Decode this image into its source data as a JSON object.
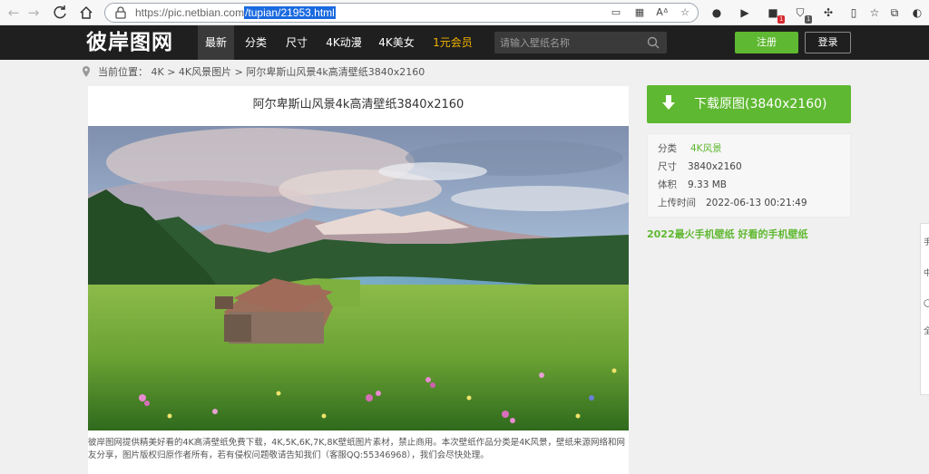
{
  "browser": {
    "url_host": "https://pic.netbian.com",
    "url_path": "/tupian/21953.html",
    "extension_badges": [
      "1",
      "1"
    ]
  },
  "site": {
    "logo": "彼岸图网",
    "nav": [
      "最新",
      "分类",
      "尺寸",
      "4K动漫",
      "4K美女",
      "1元会员"
    ],
    "search_placeholder": "请输入壁纸名称",
    "register": "注册",
    "login": "登录"
  },
  "breadcrumb": "当前位置： 4K > 4K风景图片 > 阿尔卑斯山风景4k高清壁纸3840x2160",
  "main": {
    "title": "阿尔卑斯山风景4k高清壁纸3840x2160",
    "description": "彼岸图网提供精美好看的4K高清壁纸免费下载，4K,5K,6K,7K,8K壁纸图片素材，禁止商用。本次壁纸作品分类是4K风景，壁纸来源网络和网友分享，图片版权归原作者所有，若有侵权问题敬请告知我们（客服QQ:55346968），我们会尽快处理。"
  },
  "sidebar": {
    "download_label": "下载原图(3840x2160)",
    "info": {
      "category_key": "分类",
      "category_val": "4K风景",
      "size_key": "尺寸",
      "size_val": "3840x2160",
      "volume_key": "体积",
      "volume_val": "9.33 MB",
      "uploaded_key": "上传时间",
      "uploaded_val": "2022-06-13 00:21:49"
    },
    "promo": "2022最火手机壁纸 好看的手机壁纸"
  },
  "side_float_chars": [
    "手",
    "中",
    "〇",
    "全"
  ],
  "colors": {
    "accent_green": "#5fb831",
    "header_bg": "#1f1f1f",
    "vip_gold": "#f5b400"
  }
}
